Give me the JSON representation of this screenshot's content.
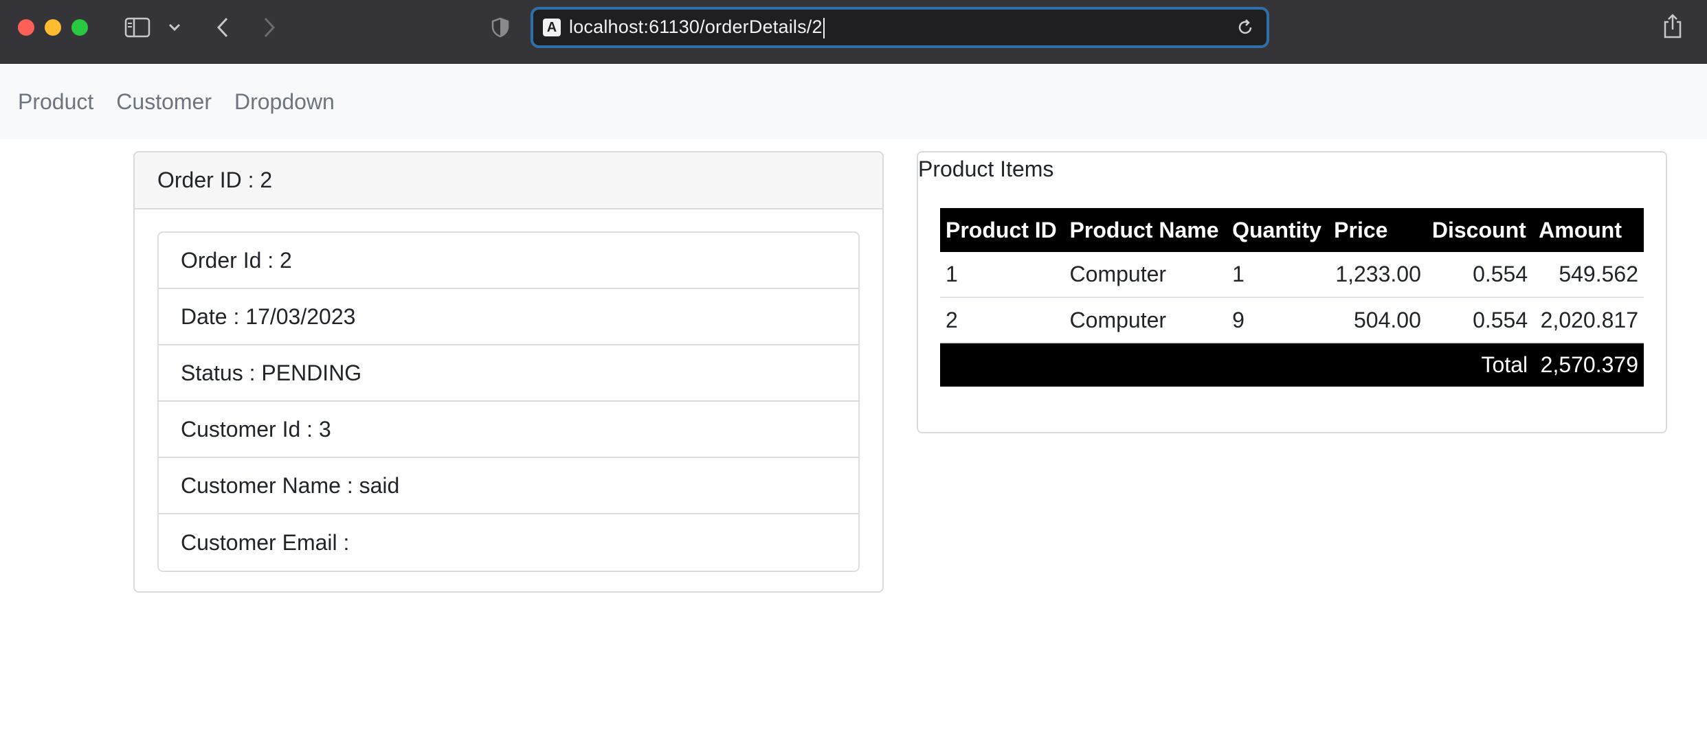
{
  "browser": {
    "url": "localhost:61130/orderDetails/2",
    "favicon_glyph": "A"
  },
  "nav": {
    "links": [
      "Product",
      "Customer",
      "Dropdown"
    ]
  },
  "order": {
    "header": "Order ID : 2",
    "fields": [
      "Order Id : 2",
      "Date : 17/03/2023",
      "Status : PENDING",
      "Customer Id : 3",
      "Customer Name : said",
      "Customer Email :"
    ]
  },
  "items": {
    "title": "Product Items",
    "columns": [
      "Product ID",
      "Product Name",
      "Quantity",
      "Price",
      "Discount",
      "Amount"
    ],
    "rows": [
      {
        "id": "1",
        "name": "Computer",
        "quantity": "1",
        "price": "1,233.00",
        "discount": "0.554",
        "amount": "549.562"
      },
      {
        "id": "2",
        "name": "Computer",
        "quantity": "9",
        "price": "504.00",
        "discount": "0.554",
        "amount": "2,020.817"
      }
    ],
    "total_label": "Total",
    "total_value": "2,570.379"
  },
  "colors": {
    "chrome_bg": "#353438",
    "url_focus": "#2f6fa7",
    "navbar_bg": "#f8f9fa",
    "table_header_bg": "#000000"
  }
}
